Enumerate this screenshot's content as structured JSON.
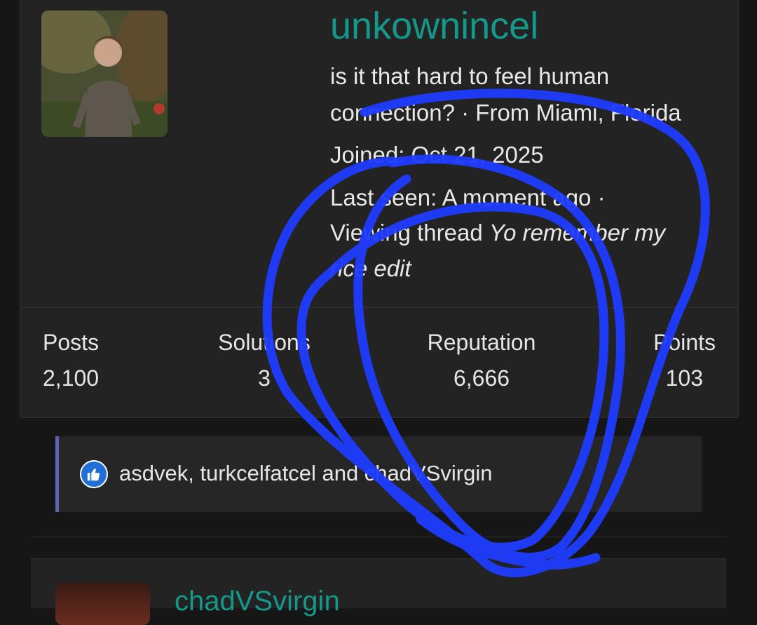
{
  "profile": {
    "username": "unkownincel",
    "bio_line1": "is it that hard to feel human",
    "bio_line2": "connection? · From Miami, Florida",
    "joined": "Joined: Oct 21, 2025",
    "last_seen_line": "Last seen: A moment ago ·",
    "viewing_prefix": "Viewing thread ",
    "viewing_title_part1": "Yo remember my",
    "viewing_title_part2": "rice edit"
  },
  "stats": [
    {
      "label": "Posts",
      "value": "2,100"
    },
    {
      "label": "Solutions",
      "value": "3"
    },
    {
      "label": "Reputation",
      "value": "6,666"
    },
    {
      "label": "Points",
      "value": "103"
    }
  ],
  "reactions": {
    "icon": "thumbs-up-icon",
    "text": "asdvek, turkcelfatcel and chadVSvirgin"
  },
  "next_post": {
    "username": "chadVSvirgin"
  },
  "colors": {
    "accent": "#14988a",
    "annotation": "#1f3cff",
    "like": "#1f6fd6"
  }
}
